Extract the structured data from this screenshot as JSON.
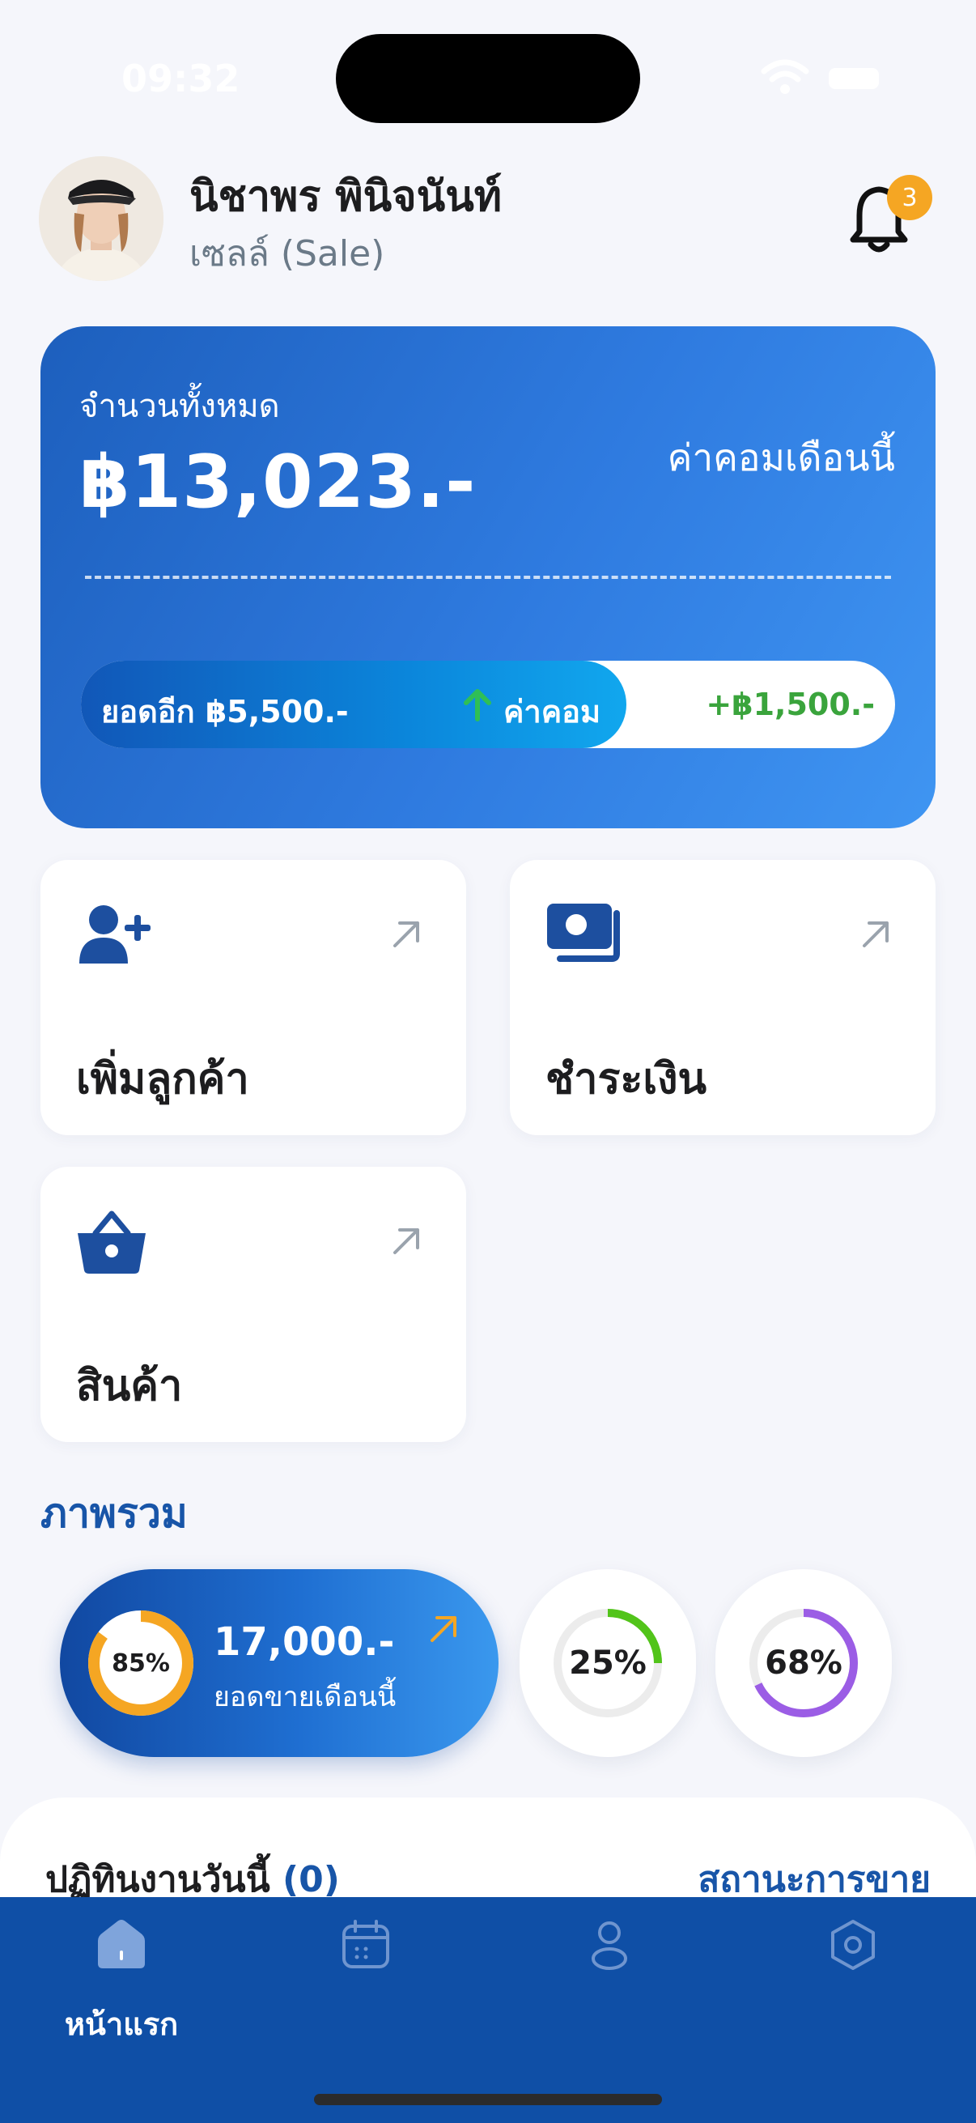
{
  "status_bar": {
    "time": "09:32"
  },
  "profile": {
    "name": "นิชาพร พินิจนันท์",
    "role": "เซลล์ (Sale)",
    "notification_count": "3"
  },
  "balance": {
    "label": "จำนวนทั้งหมด",
    "amount": "฿13,023.-",
    "commission_label": "ค่าคอมเดือนนี้",
    "remaining": "ยอดอีก ฿5,500.-",
    "progress_label": "ค่าคอม",
    "bonus": "+฿1,500.-",
    "progress_fraction": 0.67
  },
  "actions": [
    {
      "label": "เพิ่มลูกค้า",
      "icon": "add-user-icon"
    },
    {
      "label": "ชำระเงิน",
      "icon": "cash-icon"
    },
    {
      "label": "สินค้า",
      "icon": "basket-icon"
    }
  ],
  "overview": {
    "title": "ภาพรวม",
    "main": {
      "percent_label": "85%",
      "percent": 85,
      "value": "17,000.-",
      "label": "ยอดขายเดือนนี้",
      "color": "#f5a623"
    },
    "stats": [
      {
        "percent_label": "25%",
        "percent": 25,
        "color": "#52c41a"
      },
      {
        "percent_label": "68%",
        "percent": 68,
        "color": "#9b5de5"
      }
    ]
  },
  "activity": {
    "title": "ปฏิทินงานวันนี้",
    "count": "(0)",
    "link": "สถานะการขาย"
  },
  "tabbar": {
    "home_label": "หน้าแรก",
    "accent": "#0f4fa6"
  }
}
